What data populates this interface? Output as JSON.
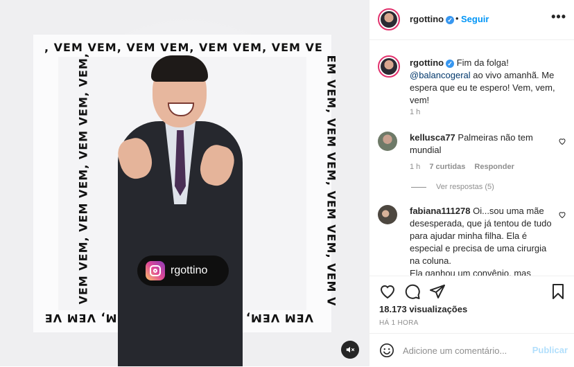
{
  "media": {
    "banner_text_top": ", VEM VEM, VEM VEM, VEM VEM, VEM VE",
    "banner_text_bottom": "VEM VEM, VEM VEM, VEM VEM, VEM VE",
    "banner_text_left": "VEM VEM, VEM VEM, VEM VEM, VEM,",
    "banner_text_right": "EM VEM, VEM VEM, VEM VEM, VEM V",
    "ig_tag_handle": "rgottino",
    "mute_icon": "speaker-muted-icon"
  },
  "header": {
    "username": "rgottino",
    "verified_mark": "✓",
    "dot": "•",
    "follow_label": "Seguir",
    "more_label": "•••"
  },
  "caption": {
    "username": "rgottino",
    "text_before": "Fim da folga!",
    "mention": "@balancogeral",
    "text_after": "ao vivo amanhã. Me espera que eu te espero! Vem, vem, vem!",
    "time": "1 h"
  },
  "comments": [
    {
      "username": "kellusca77",
      "text": "Palmeiras não tem mundial",
      "time": "1 h",
      "likes": "7 curtidas",
      "reply_label": "Responder",
      "view_replies": "Ver respostas (5)"
    },
    {
      "username": "fabiana111278",
      "text": "Oi...sou uma mãe desesperada, que já tentou de tudo para ajudar minha filha. Ela é especial e precisa de uma cirurgia na coluna.",
      "text_cont": "Ela ganhou um convênio, mas"
    }
  ],
  "actions": {
    "views": "18.173 visualizações",
    "time": "HÁ 1 HORA"
  },
  "add_comment": {
    "placeholder": "Adicione um comentário...",
    "publish_label": "Publicar"
  },
  "colors": {
    "link_blue": "#0095f6",
    "publish_disabled": "#b2dffc",
    "mention": "#00376b"
  }
}
